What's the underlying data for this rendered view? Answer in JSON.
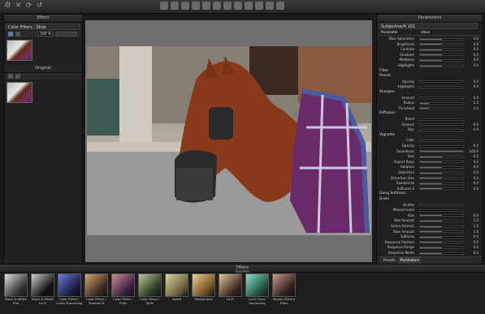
{
  "header": {
    "left_panel_title": "Effect",
    "right_panel_title": "Parameters",
    "filters_title": "Filters",
    "favorites_title": "Favorites"
  },
  "left_panel": {
    "effect_select": "Color Filters : Slide",
    "zoom_value": "100 %",
    "original_label": "Original"
  },
  "right_panel": {
    "preset_select": "Subjective/4 101",
    "col_param": "Parameter",
    "col_value": "Value",
    "rows": [
      {
        "label": "Blue Saturation",
        "value": "0.0",
        "level": 0.5
      },
      {
        "label": "Brightness",
        "value": "0.0",
        "level": 0.5
      },
      {
        "label": "Contrast",
        "value": "0.0",
        "level": 0.5
      },
      {
        "label": "Shadows",
        "value": "0.0",
        "level": 0.5
      },
      {
        "label": "Midtones",
        "value": "0.0",
        "level": 0.5
      },
      {
        "label": "Highlights",
        "value": "0.0",
        "level": 0.5
      }
    ],
    "filter_section": "Filter",
    "preset_label": "Preset",
    "filter_rows": [
      {
        "label": "Opacity",
        "value": "0.0",
        "level": 0.0
      },
      {
        "label": "Highlights",
        "value": "0.0",
        "level": 0.0
      }
    ],
    "sharpen_section": "Sharpen",
    "sharpen_rows": [
      {
        "label": "Amount",
        "value": "0.0",
        "level": 0.0
      },
      {
        "label": "Radius",
        "value": "1.0",
        "level": 0.2
      },
      {
        "label": "Threshold",
        "value": "1.0",
        "level": 0.2
      }
    ],
    "diffusion_section": "Diffusion",
    "diffusion_rows": [
      {
        "label": "Blend",
        "value": "",
        "level": 0.0
      },
      {
        "label": "Amount",
        "value": "0.0",
        "level": 0.0
      },
      {
        "label": "Blur",
        "value": "0.0",
        "level": 0.0
      }
    ],
    "vignette_section": "Vignette",
    "vignette_rows": [
      {
        "label": "Color",
        "value": "",
        "level": 0.0
      },
      {
        "label": "Opacity",
        "value": "0.0",
        "level": 0.0
      },
      {
        "label": "Roundness",
        "value": "100.0",
        "level": 1.0
      },
      {
        "label": "Size",
        "value": "0.0",
        "level": 0.5
      },
      {
        "label": "Aspect Ratio",
        "value": "0.0",
        "level": 0.5
      },
      {
        "label": "Rotation",
        "value": "0.0",
        "level": 0.5
      },
      {
        "label": "Distortion",
        "value": "0.0",
        "level": 0.5
      },
      {
        "label": "Distortion Size",
        "value": "0.0",
        "level": 0.5
      },
      {
        "label": "Randomize",
        "value": "0.0",
        "level": 0.5
      },
      {
        "label": "Softness X",
        "value": "0.0",
        "level": 0.5
      }
    ],
    "gang_label": "Gang Softness",
    "grain_section": "Grain",
    "grain_rows": [
      {
        "label": "Enable",
        "value": "",
        "level": 0.0
      },
      {
        "label": "Monochrome",
        "value": "",
        "level": 0.0
      },
      {
        "label": "Size",
        "value": "0.0",
        "level": 0.5
      },
      {
        "label": "Red Amount",
        "value": "1.0",
        "level": 0.5
      },
      {
        "label": "Green Amount",
        "value": "1.0",
        "level": 0.5
      },
      {
        "label": "Blue Amount",
        "value": "1.0",
        "level": 0.5
      },
      {
        "label": "Softness",
        "value": "0.0",
        "level": 0.5
      },
      {
        "label": "Response Position",
        "value": "0.0",
        "level": 0.5
      },
      {
        "label": "Response Range",
        "value": "0.0",
        "level": 0.5
      },
      {
        "label": "Response Width",
        "value": "0.0",
        "level": 0.5
      }
    ],
    "tab_presets": "Presets",
    "tab_parameters": "Parameters"
  },
  "filters": [
    {
      "label": "Black & White Film",
      "c1": "#e0e0e0",
      "c2": "#333333"
    },
    {
      "label": "Black & White Lo-Fi",
      "c1": "#cfcfcf",
      "c2": "#111111"
    },
    {
      "label": "Color Filters : Cross Processing",
      "c1": "#6b7bd8",
      "c2": "#1a1a40"
    },
    {
      "label": "Color Filters : Polaroid 8",
      "c1": "#d7a86a",
      "c2": "#3a2a20"
    },
    {
      "label": "Color Filters : Print",
      "c1": "#cf8a9a",
      "c2": "#3a2040"
    },
    {
      "label": "Color Filters : Slide",
      "c1": "#b8c89a",
      "c2": "#2a3a20"
    },
    {
      "label": "Faded",
      "c1": "#dcd4a0",
      "c2": "#6a6040"
    },
    {
      "label": "Hipstamatic",
      "c1": "#f0d090",
      "c2": "#705020"
    },
    {
      "label": "Lo-Fi",
      "c1": "#e0c8a0",
      "c2": "#402820"
    },
    {
      "label": "Lo-Fi Cross Processing",
      "c1": "#8ae0c8",
      "c2": "#205040"
    },
    {
      "label": "Motion Picture Films",
      "c1": "#c89a8a",
      "c2": "#302020"
    }
  ]
}
